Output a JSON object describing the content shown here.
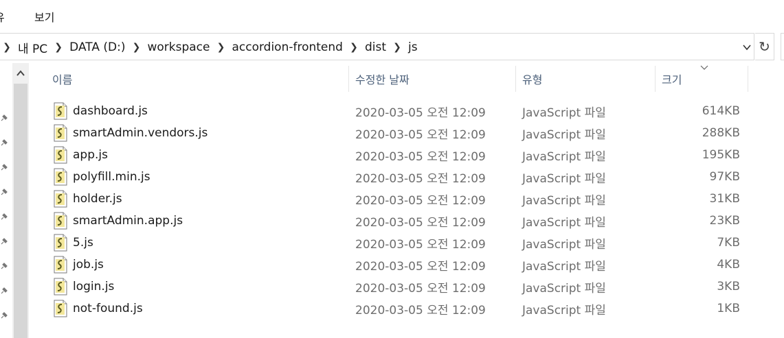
{
  "menubar": {
    "items": [
      {
        "label": "유"
      },
      {
        "label": "보기"
      }
    ]
  },
  "address": {
    "crumbs": [
      "내 PC",
      "DATA (D:)",
      "workspace",
      "accordion-frontend",
      "dist",
      "js"
    ]
  },
  "columns": {
    "name": "이름",
    "modified": "수정한 날짜",
    "type": "유형",
    "size": "크기"
  },
  "files": [
    {
      "name": "dashboard.js",
      "modified": "2020-03-05 오전 12:09",
      "type": "JavaScript 파일",
      "size": "614KB"
    },
    {
      "name": "smartAdmin.vendors.js",
      "modified": "2020-03-05 오전 12:09",
      "type": "JavaScript 파일",
      "size": "288KB"
    },
    {
      "name": "app.js",
      "modified": "2020-03-05 오전 12:09",
      "type": "JavaScript 파일",
      "size": "195KB"
    },
    {
      "name": "polyfill.min.js",
      "modified": "2020-03-05 오전 12:09",
      "type": "JavaScript 파일",
      "size": "97KB"
    },
    {
      "name": "holder.js",
      "modified": "2020-03-05 오전 12:09",
      "type": "JavaScript 파일",
      "size": "31KB"
    },
    {
      "name": "smartAdmin.app.js",
      "modified": "2020-03-05 오전 12:09",
      "type": "JavaScript 파일",
      "size": "23KB"
    },
    {
      "name": "5.js",
      "modified": "2020-03-05 오전 12:09",
      "type": "JavaScript 파일",
      "size": "7KB"
    },
    {
      "name": "job.js",
      "modified": "2020-03-05 오전 12:09",
      "type": "JavaScript 파일",
      "size": "4KB"
    },
    {
      "name": "login.js",
      "modified": "2020-03-05 오전 12:09",
      "type": "JavaScript 파일",
      "size": "3KB"
    },
    {
      "name": "not-found.js",
      "modified": "2020-03-05 오전 12:09",
      "type": "JavaScript 파일",
      "size": "1KB"
    }
  ],
  "colors": {
    "header_text": "#4c607a",
    "detail_text": "#6d6d6d"
  }
}
